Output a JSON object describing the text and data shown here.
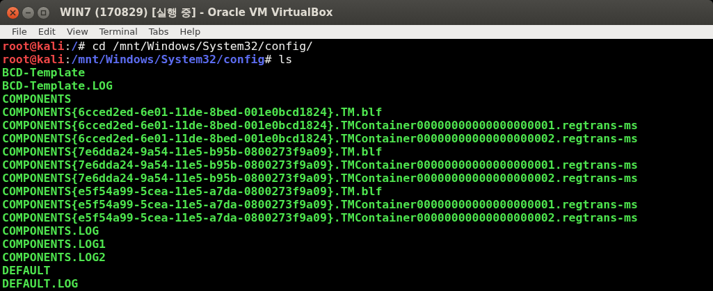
{
  "window": {
    "title": "WIN7 (170829) [실행 중] - Oracle VM VirtualBox"
  },
  "menu": [
    {
      "label": "File"
    },
    {
      "label": "Edit"
    },
    {
      "label": "View"
    },
    {
      "label": "Terminal"
    },
    {
      "label": "Tabs"
    },
    {
      "label": "Help"
    }
  ],
  "terminal": {
    "lines": [
      {
        "kind": "prompt",
        "user": "root@kali",
        "separator": ":",
        "path": "/",
        "command": "# cd /mnt/Windows/System32/config/"
      },
      {
        "kind": "prompt",
        "user": "root@kali",
        "separator": ":",
        "path": "/mnt/Windows/System32/config",
        "command": "# ls"
      },
      {
        "kind": "output",
        "text": "BCD-Template"
      },
      {
        "kind": "output",
        "text": "BCD-Template.LOG"
      },
      {
        "kind": "output",
        "text": "COMPONENTS"
      },
      {
        "kind": "output",
        "text": "COMPONENTS{6cced2ed-6e01-11de-8bed-001e0bcd1824}.TM.blf"
      },
      {
        "kind": "output",
        "text": "COMPONENTS{6cced2ed-6e01-11de-8bed-001e0bcd1824}.TMContainer00000000000000000001.regtrans-ms"
      },
      {
        "kind": "output",
        "text": "COMPONENTS{6cced2ed-6e01-11de-8bed-001e0bcd1824}.TMContainer00000000000000000002.regtrans-ms"
      },
      {
        "kind": "output",
        "text": "COMPONENTS{7e6dda24-9a54-11e5-b95b-0800273f9a09}.TM.blf"
      },
      {
        "kind": "output",
        "text": "COMPONENTS{7e6dda24-9a54-11e5-b95b-0800273f9a09}.TMContainer00000000000000000001.regtrans-ms"
      },
      {
        "kind": "output",
        "text": "COMPONENTS{7e6dda24-9a54-11e5-b95b-0800273f9a09}.TMContainer00000000000000000002.regtrans-ms"
      },
      {
        "kind": "output",
        "text": "COMPONENTS{e5f54a99-5cea-11e5-a7da-0800273f9a09}.TM.blf"
      },
      {
        "kind": "output",
        "text": "COMPONENTS{e5f54a99-5cea-11e5-a7da-0800273f9a09}.TMContainer00000000000000000001.regtrans-ms"
      },
      {
        "kind": "output",
        "text": "COMPONENTS{e5f54a99-5cea-11e5-a7da-0800273f9a09}.TMContainer00000000000000000002.regtrans-ms"
      },
      {
        "kind": "output",
        "text": "COMPONENTS.LOG"
      },
      {
        "kind": "output",
        "text": "COMPONENTS.LOG1"
      },
      {
        "kind": "output",
        "text": "COMPONENTS.LOG2"
      },
      {
        "kind": "output",
        "text": "DEFAULT"
      },
      {
        "kind": "output",
        "text": "DEFAULT.LOG"
      }
    ]
  }
}
